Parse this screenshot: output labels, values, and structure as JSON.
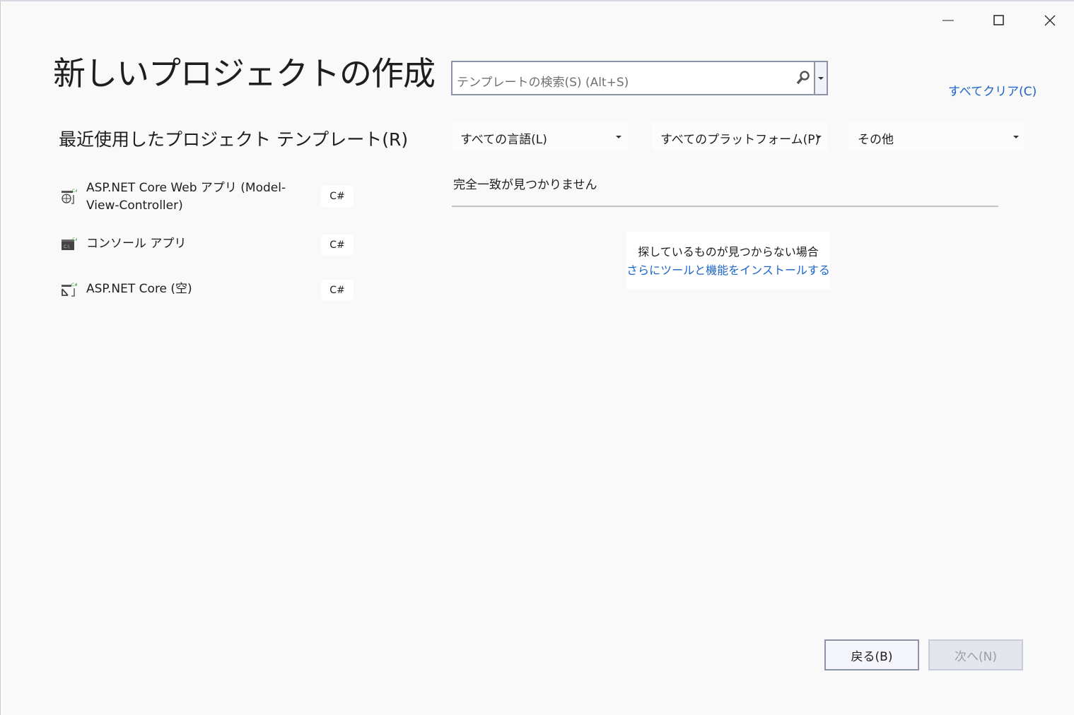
{
  "window": {
    "minimize_icon": "minimize-icon",
    "maximize_icon": "maximize-icon",
    "close_icon": "close-icon"
  },
  "title": "新しいプロジェクトの作成",
  "recent": {
    "heading": "最近使用したプロジェクト テンプレート(R)",
    "items": [
      {
        "label": "ASP.NET Core Web アプリ (Model-View-Controller)",
        "lang": "C#",
        "icon": "web-app-icon"
      },
      {
        "label": "コンソール アプリ",
        "lang": "C#",
        "icon": "console-app-icon"
      },
      {
        "label": "ASP.NET Core (空)",
        "lang": "C#",
        "icon": "empty-web-icon"
      }
    ]
  },
  "search": {
    "placeholder": "テンプレートの検索(S) (Alt+S)"
  },
  "clear_all": "すべてクリア(C)",
  "filters": {
    "language": "すべての言語(L)",
    "platform": "すべてのプラットフォーム(P)",
    "type": "その他"
  },
  "no_match": "完全一致が見つかりません",
  "hint": {
    "text": "探しているものが見つからない場合",
    "link": "さらにツールと機能をインストールする"
  },
  "buttons": {
    "back": "戻る(B)",
    "next": "次へ(N)"
  },
  "colors": {
    "accent": "#1a64c8",
    "csharp_green": "#3c9a3c"
  }
}
